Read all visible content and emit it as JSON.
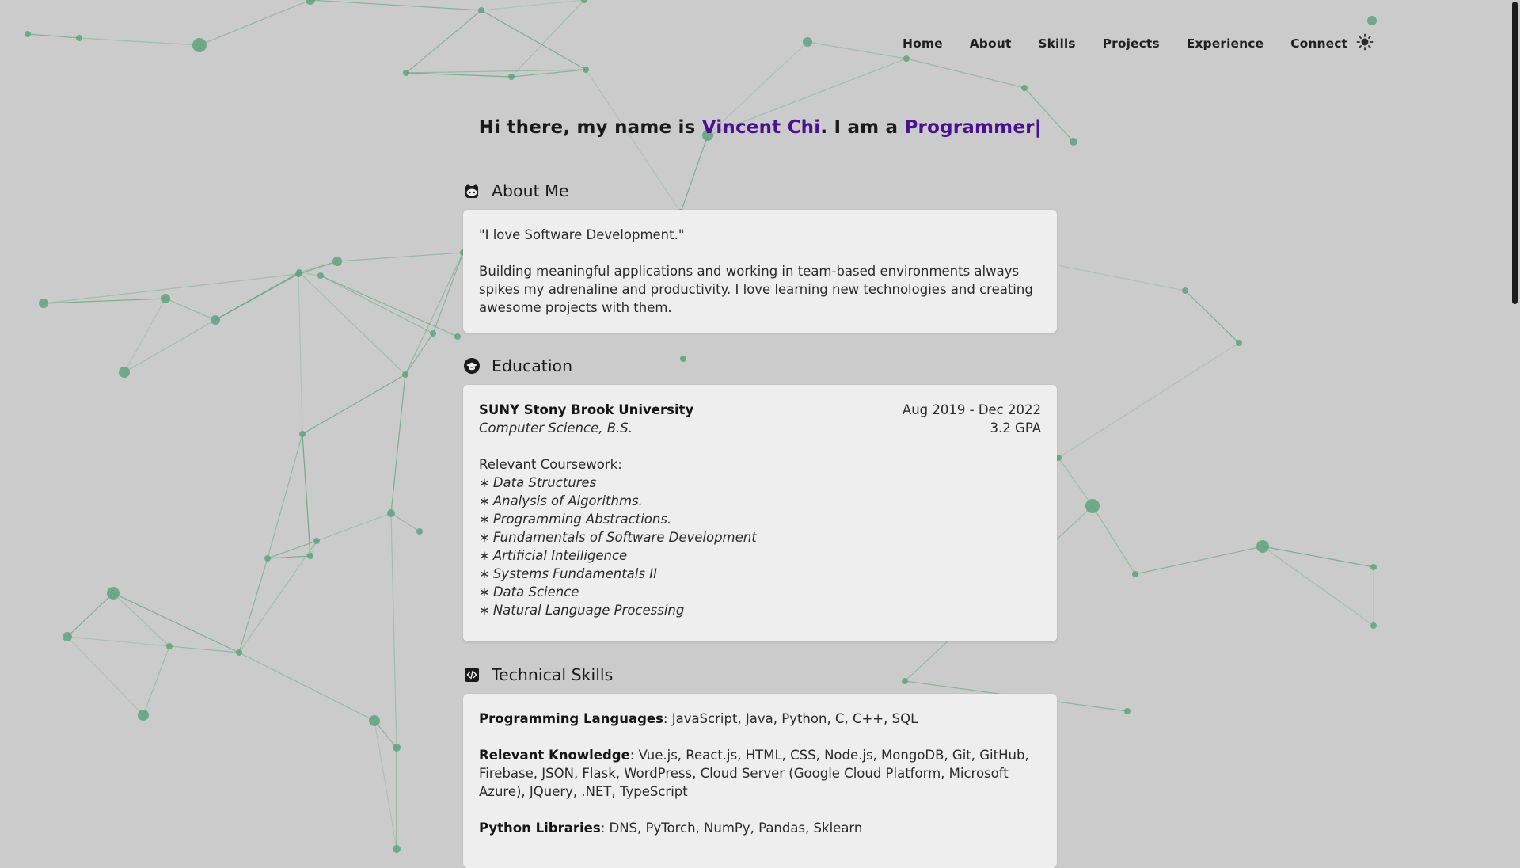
{
  "nav": {
    "items": [
      "Home",
      "About",
      "Skills",
      "Projects",
      "Experience",
      "Connect"
    ],
    "theme_toggle_icon": "sun-icon"
  },
  "hero": {
    "prefix": "Hi there, my name is ",
    "name": "Vincent Chi",
    "middle": ". I am a ",
    "role": "Programmer",
    "cursor": "|",
    "accent_color": "#4b1090"
  },
  "about": {
    "heading": "About Me",
    "icon": "github-octocat-icon",
    "quote": "\"I love Software Development.\"",
    "body": "Building meaningful applications and working in team-based environments always spikes my adrenaline and productivity. I love learning new technologies and creating awesome projects with them."
  },
  "education": {
    "heading": "Education",
    "icon": "graduation-cap-icon",
    "school": "SUNY Stony Brook University",
    "degree": "Computer Science, B.S.",
    "dates": "Aug 2019 - Dec 2022",
    "gpa": "3.2 GPA",
    "coursework_label": "Relevant Coursework:",
    "bullet": "∗",
    "courses": [
      "Data Structures",
      "Analysis of Algorithms.",
      "Programming Abstractions.",
      "Fundamentals of Software Development",
      "Artificial Intelligence",
      "Systems Fundamentals II",
      "Data Science",
      "Natural Language Processing"
    ]
  },
  "skills": {
    "heading": "Technical Skills",
    "icon": "code-icon",
    "groups": [
      {
        "label": "Programming Languages",
        "value": ": JavaScript, Java, Python, C, C++, SQL"
      },
      {
        "label": "Relevant Knowledge",
        "value": ": Vue.js, React.js, HTML, CSS, Node.js, MongoDB, Git, GitHub, Firebase, JSON, Flask, WordPress, Cloud Server (Google Cloud Platform, Microsoft Azure), JQuery, .NET, TypeScript"
      },
      {
        "label": "Python Libraries",
        "value": ": DNS, PyTorch, NumPy, Pandas, Sklearn"
      }
    ]
  },
  "colors": {
    "background": "#cbcbcb",
    "card": "#eeeeee",
    "network": "#5fa37d"
  }
}
